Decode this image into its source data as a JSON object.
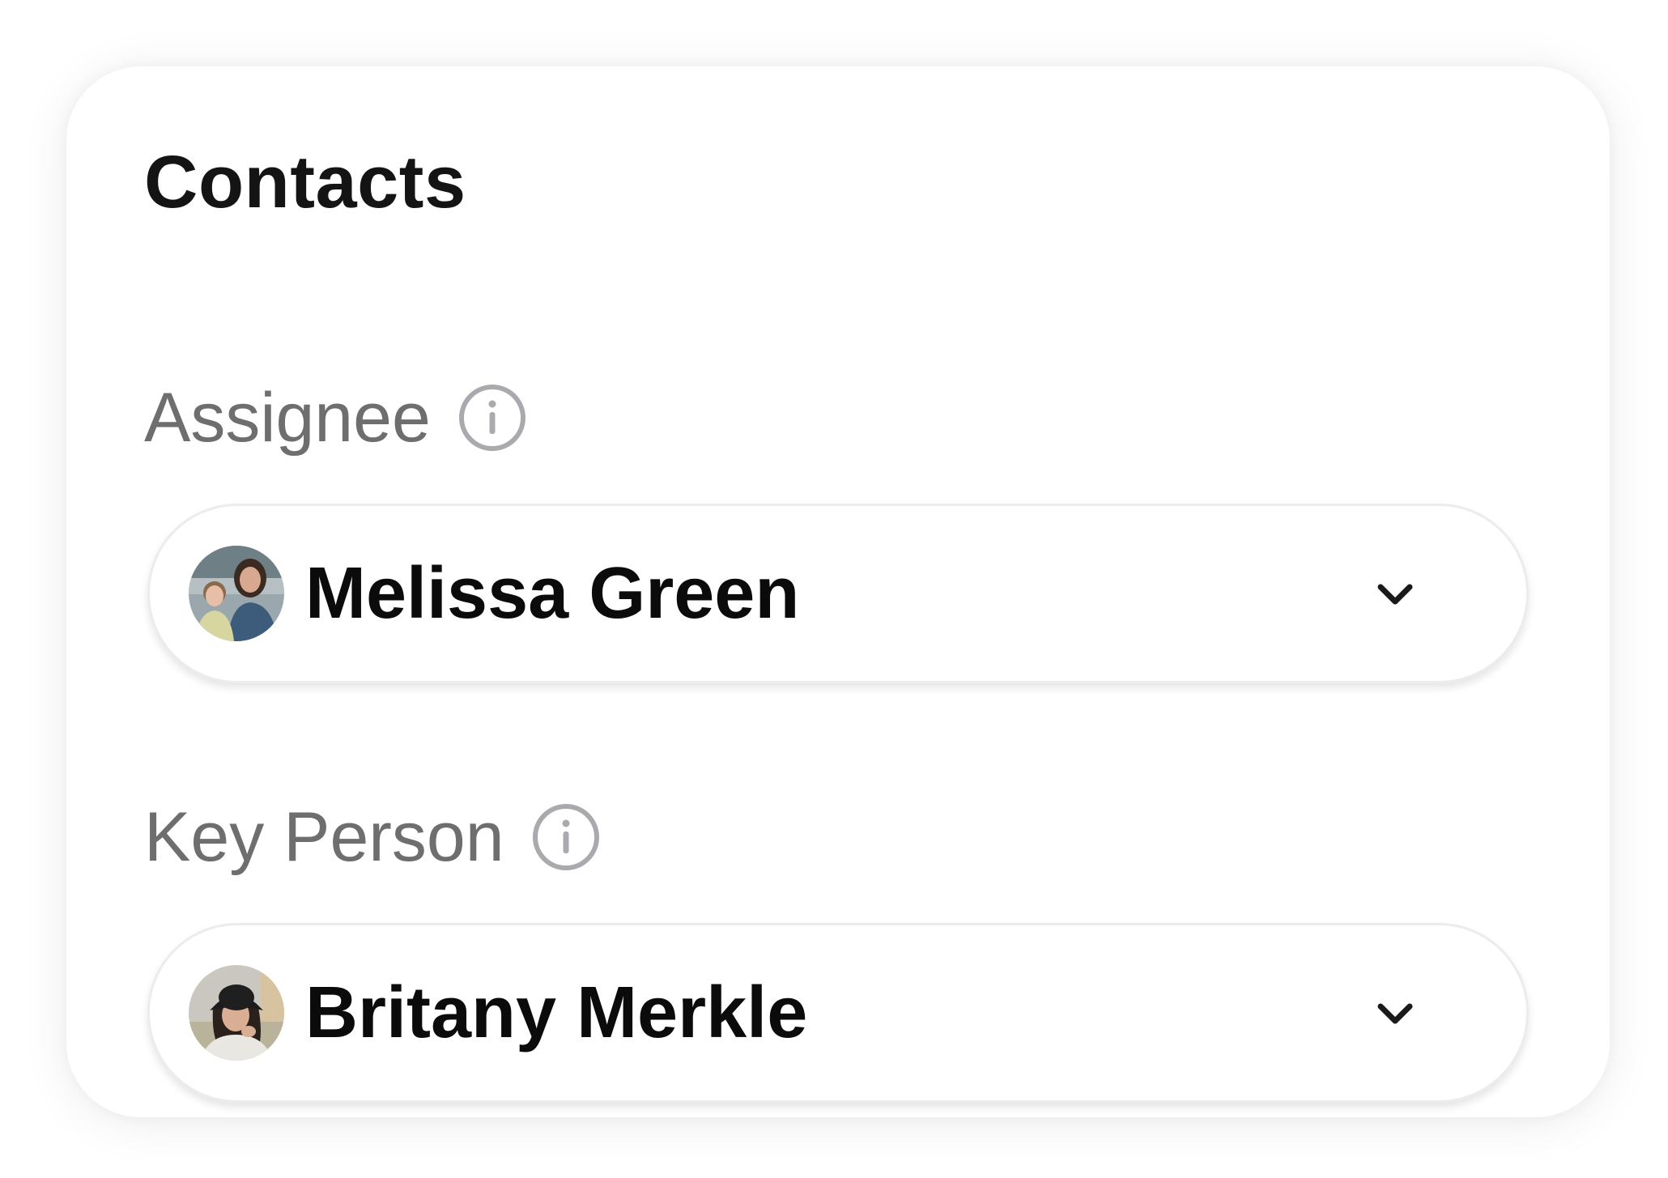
{
  "card": {
    "title": "Contacts"
  },
  "fields": [
    {
      "label": "Assignee",
      "info_icon": "info-circle-icon",
      "value": "Melissa Green",
      "avatar": "photo-avatar-woman-and-child",
      "dropdown_icon": "chevron-down-icon"
    },
    {
      "label": "Key Person",
      "info_icon": "info-circle-icon",
      "value": "Britany Merkle",
      "avatar": "photo-avatar-woman-bucket-hat",
      "dropdown_icon": "chevron-down-icon"
    }
  ],
  "colors": {
    "title": "#141414",
    "label": "#6e6e6e",
    "value": "#0b0b0b",
    "icon": "#a9a9ae",
    "background": "#ffffff"
  }
}
